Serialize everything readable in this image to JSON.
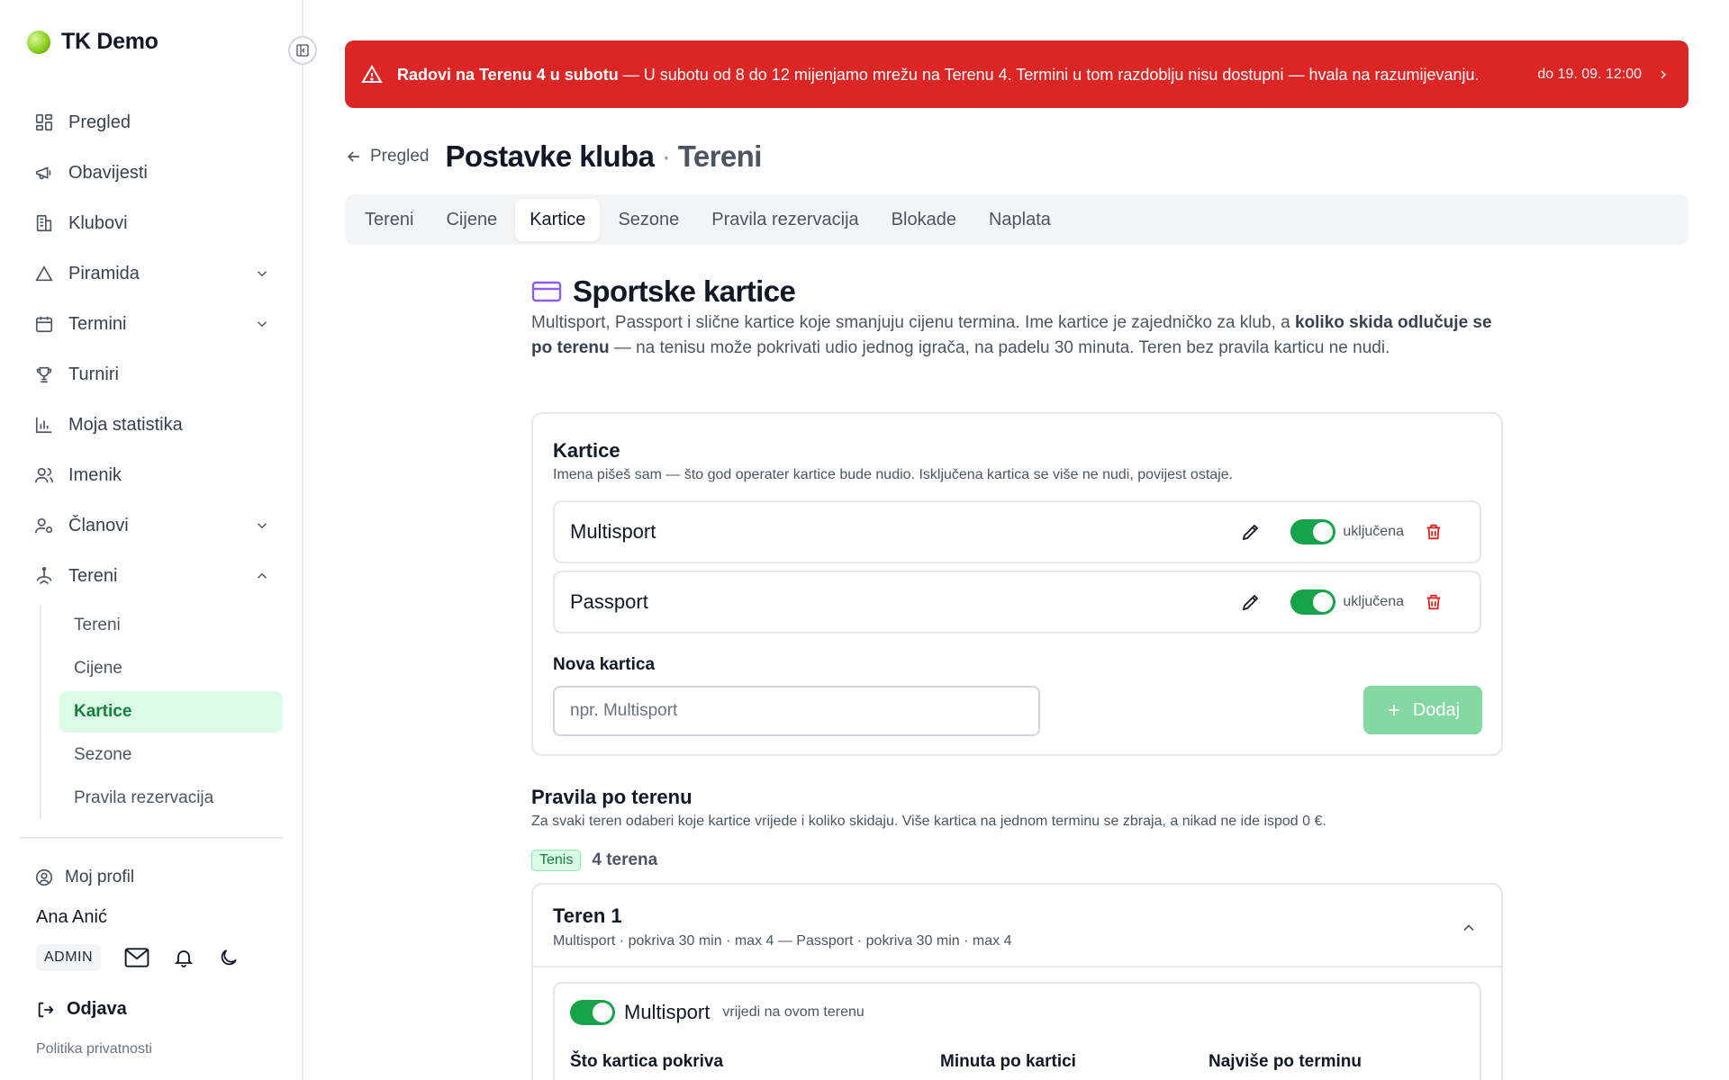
{
  "brand": {
    "name": "TK Demo"
  },
  "sidebar": {
    "items": [
      {
        "label": "Pregled",
        "icon": "dashboard-icon"
      },
      {
        "label": "Obavijesti",
        "icon": "megaphone-icon"
      },
      {
        "label": "Klubovi",
        "icon": "building-icon"
      },
      {
        "label": "Piramida",
        "icon": "triangle-icon",
        "expandable": true
      },
      {
        "label": "Termini",
        "icon": "calendar-icon",
        "expandable": true
      },
      {
        "label": "Turniri",
        "icon": "trophy-icon"
      },
      {
        "label": "Moja statistika",
        "icon": "bar-chart-icon"
      },
      {
        "label": "Imenik",
        "icon": "users-icon"
      },
      {
        "label": "Članovi",
        "icon": "user-settings-icon",
        "expandable": true
      },
      {
        "label": "Tereni",
        "icon": "court-icon",
        "expanded": true
      }
    ],
    "subitems": [
      {
        "label": "Tereni"
      },
      {
        "label": "Cijene"
      },
      {
        "label": "Kartice",
        "active": true
      },
      {
        "label": "Sezone"
      },
      {
        "label": "Pravila rezervacija"
      }
    ],
    "profile_link": "Moj profil",
    "user_name": "Ana Anić",
    "role": "ADMIN",
    "logout": "Odjava",
    "privacy": "Politika privatnosti"
  },
  "alert": {
    "title": "Radovi na Terenu 4 u subotu",
    "message": " — U subotu od 8 do 12 mijenjamo mrežu na Terenu 4. Termini u tom razdoblju nisu dostupni — hvala na razumijevanju.",
    "until": "do 19. 09. 12:00",
    "color": "#dc2626"
  },
  "header": {
    "back_label": "Pregled",
    "title": "Postavke kluba",
    "separator": "·",
    "subtitle": "Tereni"
  },
  "tabs": [
    {
      "label": "Tereni"
    },
    {
      "label": "Cijene"
    },
    {
      "label": "Kartice",
      "active": true
    },
    {
      "label": "Sezone"
    },
    {
      "label": "Pravila rezervacija"
    },
    {
      "label": "Blokade"
    },
    {
      "label": "Naplata"
    }
  ],
  "section": {
    "title": "Sportske kartice",
    "desc_part1": "Multisport, Passport i slične kartice koje smanjuju cijenu termina. Ime kartice je zajedničko za klub, a ",
    "desc_bold": "koliko skida odlučuje se po terenu",
    "desc_part2": " — na tenisu može pokrivati udio jednog igrača, na padelu 30 minuta. Teren bez pravila karticu ne nudi."
  },
  "cards_panel": {
    "title": "Kartice",
    "subtitle": "Imena pišeš sam — što god operater kartice bude nudio. Isključena kartica se više ne nudi, povijest ostaje.",
    "cards": [
      {
        "name": "Multisport",
        "status": "uključena",
        "enabled": true
      },
      {
        "name": "Passport",
        "status": "uključena",
        "enabled": true
      }
    ],
    "new_label": "Nova kartica",
    "new_placeholder": "npr. Multisport",
    "add_label": "Dodaj"
  },
  "rules": {
    "title": "Pravila po terenu",
    "subtitle": "Za svaki teren odaberi koje kartice vrijede i koliko skidaju. Više kartica na jednom terminu se zbraja, a nikad ne ide ispod 0 €.",
    "sport_tag": "Tenis",
    "court_count": "4 terena",
    "court": {
      "title": "Teren 1",
      "summary": "Multisport · pokriva 30 min · max 4 — Passport · pokriva 30 min · max 4",
      "card_name": "Multisport",
      "card_note": "vrijedi na ovom terenu",
      "fields": [
        {
          "label": "Što kartica pokriva"
        },
        {
          "label": "Minuta po kartici"
        },
        {
          "label": "Najviše po terminu"
        }
      ]
    }
  },
  "colors": {
    "accent_green": "#16a34a",
    "active_bg": "#dcfce7",
    "danger": "#dc2626",
    "card_icon": "#8b5cf6"
  }
}
